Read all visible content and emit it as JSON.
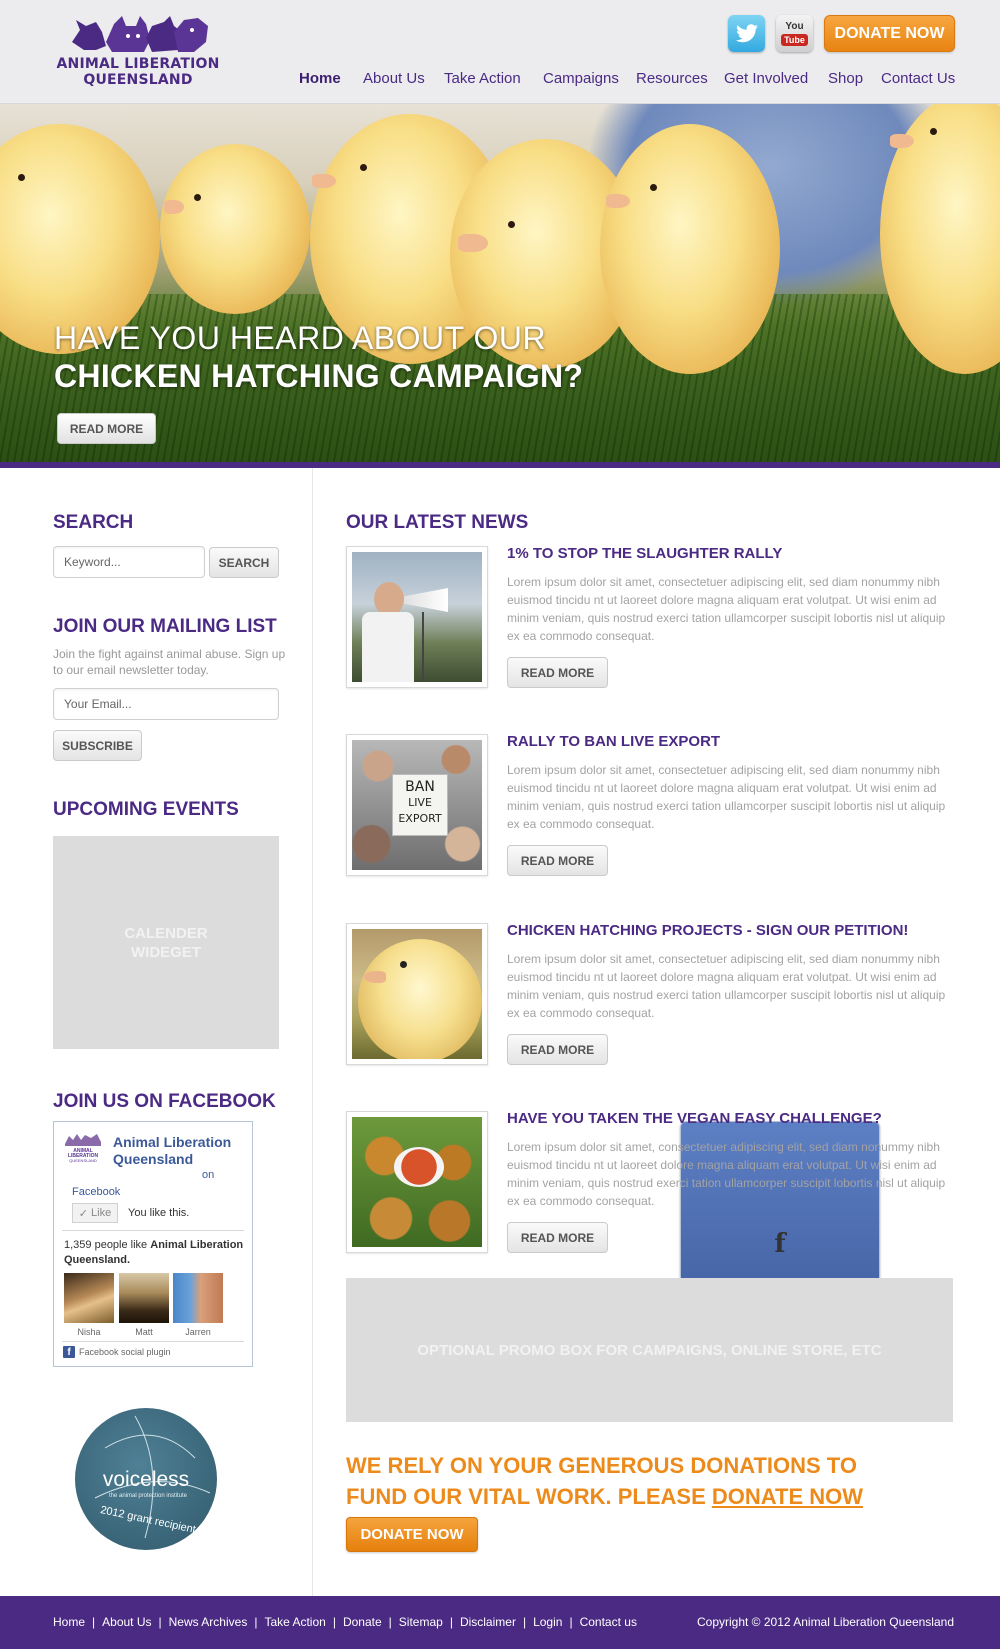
{
  "brand": {
    "name_line1": "ANIMAL LIBERATION",
    "name_line2": "QUEENSLAND",
    "color_primary": "#4b2a84",
    "color_accent": "#ec8b1c"
  },
  "header": {
    "social": [
      {
        "name": "facebook",
        "icon": "facebook-icon",
        "glyph": "f"
      },
      {
        "name": "twitter",
        "icon": "twitter-icon",
        "glyph": "t"
      },
      {
        "name": "youtube",
        "icon": "youtube-icon",
        "glyph_top": "You",
        "glyph_bottom": "Tube"
      }
    ],
    "donate_label": "DONATE NOW",
    "nav": [
      "Home",
      "About Us",
      "Take Action",
      "Campaigns",
      "Resources",
      "Get Involved",
      "Shop",
      "Contact Us"
    ],
    "nav_active": "Home"
  },
  "hero": {
    "line1": "HAVE YOU HEARD ABOUT OUR",
    "line2": "CHICKEN HATCHING CAMPAIGN?",
    "button": "READ MORE"
  },
  "sidebar": {
    "search": {
      "heading": "SEARCH",
      "placeholder": "Keyword...",
      "button": "SEARCH"
    },
    "mailing": {
      "heading": "JOIN OUR MAILING LIST",
      "description": "Join the fight against animal abuse. Sign up to our email newsletter today.",
      "placeholder": "Your Email...",
      "button": "SUBSCRIBE"
    },
    "events": {
      "heading": "UPCOMING EVENTS",
      "placeholder_text": "CALENDER WIDEGET"
    },
    "facebook": {
      "heading": "JOIN US ON FACEBOOK",
      "page_name": "Animal Liberation Queensland",
      "on_text": "on",
      "platform": "Facebook",
      "like_button": "Like",
      "you_like": "You like this.",
      "count_prefix": "1,359 people like",
      "count_page": "Animal Liberation Queensland.",
      "fans": [
        "Nisha",
        "Matt",
        "Jarren"
      ],
      "plugin_text": "Facebook social plugin",
      "logo_text_line1": "ANIMAL",
      "logo_text_line2": "LIBERATION",
      "logo_text_line3": "QUEENSLAND"
    },
    "badge": {
      "name": "voiceless",
      "tagline": "the animal protection institute",
      "award": "2012 grant recipient"
    }
  },
  "main": {
    "news_heading": "OUR LATEST NEWS",
    "news": [
      {
        "title": "1% TO STOP THE SLAUGHTER RALLY",
        "body": "Lorem ipsum dolor sit amet, consectetuer adipiscing elit, sed diam nonummy nibh euismod tincidu nt ut laoreet dolore magna aliquam erat volutpat. Ut wisi enim ad minim veniam, quis nostrud exerci tation ullamcorper suscipit lobortis nisl ut aliquip ex ea commodo consequat.",
        "button": "READ MORE",
        "image": "megaphone-speaker-photo"
      },
      {
        "title": "RALLY TO BAN LIVE EXPORT",
        "body": "Lorem ipsum dolor sit amet, consectetuer adipiscing elit, sed diam nonummy nibh euismod tincidu nt ut laoreet dolore magna aliquam erat volutpat. Ut wisi enim ad minim veniam, quis nostrud exerci tation ullamcorper suscipit lobortis nisl ut aliquip ex ea commodo consequat.",
        "button": "READ MORE",
        "image": "protest-sign-photo",
        "sign_text": [
          "BAN",
          "LIVE",
          "EXPORT"
        ]
      },
      {
        "title": "CHICKEN HATCHING PROJECTS - SIGN OUR PETITION!",
        "body": "Lorem ipsum dolor sit amet, consectetuer adipiscing elit, sed diam nonummy nibh euismod tincidu nt ut laoreet dolore magna aliquam erat volutpat. Ut wisi enim ad minim veniam, quis nostrud exerci tation ullamcorper suscipit lobortis nisl ut aliquip ex ea commodo consequat.",
        "button": "READ MORE",
        "image": "chick-photo"
      },
      {
        "title": "HAVE YOU TAKEN THE VEGAN EASY CHALLENGE?",
        "body": "Lorem ipsum dolor sit amet, consectetuer adipiscing elit, sed diam nonummy nibh euismod tincidu nt ut laoreet dolore magna aliquam erat volutpat. Ut wisi enim ad minim veniam, quis nostrud exerci tation ullamcorper suscipit lobortis nisl ut aliquip ex ea commodo consequat.",
        "button": "READ MORE",
        "image": "vegan-food-photo"
      }
    ],
    "promo_text": "OPTIONAL PROMO BOX FOR CAMPAIGNS, ONLINE STORE, ETC",
    "donate_message_line1": "WE RELY ON YOUR GENEROUS DONATIONS TO",
    "donate_message_line2": "FUND OUR VITAL WORK. PLEASE",
    "donate_message_link": "DONATE NOW",
    "donate_button": "DONATE NOW"
  },
  "footer": {
    "links": [
      "Home",
      "About Us",
      "News Archives",
      "Take Action",
      "Donate",
      "Sitemap",
      "Disclaimer",
      "Login",
      "Contact us"
    ],
    "separator": "|",
    "copyright": "Copyright © 2012 Animal Liberation Queensland"
  }
}
